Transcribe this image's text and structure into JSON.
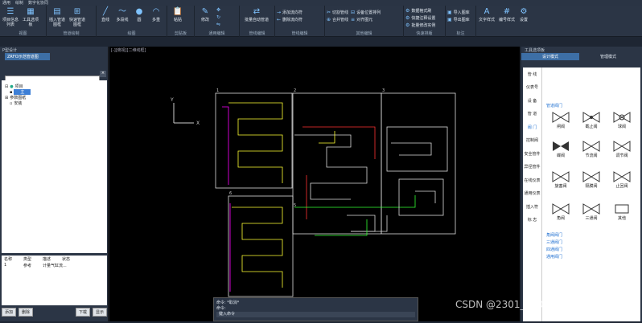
{
  "menubar": {
    "items": [
      "通用",
      "绘制",
      "数字化协同"
    ]
  },
  "ribbon": {
    "groups": [
      {
        "label": "视图",
        "buttons": [
          "项目信息列表",
          "工具选项板"
        ]
      },
      {
        "label": "管道绘制",
        "buttons": [
          "插入管道图框",
          "快速管道图框"
        ]
      },
      {
        "label": "绘图",
        "buttons": [
          "直线",
          "多段线",
          "圆",
          "多重"
        ]
      },
      {
        "label": "剪贴板",
        "buttons": [
          "粘贴"
        ]
      },
      {
        "label": "通用编辑",
        "buttons": [
          "修改"
        ]
      },
      {
        "label": "管线编辑",
        "buttons": [
          "批量自动管道"
        ]
      },
      {
        "label": "管线编辑2",
        "small": [
          "添加流向符",
          "删除流向符"
        ]
      },
      {
        "label": "其他编辑",
        "small": [
          "切割管线",
          "合并管线",
          "设备位置排列",
          "对齐图元"
        ]
      },
      {
        "label": "快速排版",
        "small": [
          "数据格式刷",
          "快捷注释设置",
          "批量修改实例"
        ]
      },
      {
        "label": "标注",
        "small": [
          "导入图库",
          "导出图库"
        ]
      },
      {
        "label": "标注2",
        "buttons": [
          "文字样式",
          "编号样式",
          "设置"
        ]
      }
    ]
  },
  "left": {
    "title": "P型设计",
    "tab": "ZRFO示范管道图",
    "search_placeholder": "",
    "tree": [
      "项目",
      "主",
      "参数图纸",
      "安装"
    ],
    "props_headers": [
      "名称",
      "类型",
      "描述",
      "状态"
    ],
    "props_row": [
      "1",
      "参考",
      "计量气缸流..."
    ],
    "footer": [
      "添加",
      "删除",
      "下载",
      "显示"
    ]
  },
  "canvas": {
    "doc_label": "[-][俯视][二维线框]",
    "cmd_lines": [
      "命令: *取消*",
      "命令:",
      "键入命令"
    ]
  },
  "right": {
    "title": "工具选项板",
    "tabs": [
      "设计模式",
      "管理模式"
    ],
    "categories": [
      "管  线",
      "仪表号",
      "设  备",
      "管  道",
      "阀  门",
      "控制阀",
      "安全管件",
      "异径管件",
      "在线仪表",
      "通用仪表",
      "插入符",
      "标  志"
    ],
    "group_label": "管道阀门",
    "symbols": [
      "闸阀",
      "截止阀",
      "球阀",
      "蝶阀",
      "节流阀",
      "调节阀",
      "旋塞阀",
      "隔膜阀",
      "止回阀",
      "角阀",
      "三通阀",
      "其他"
    ],
    "subgroups": [
      "角阀阀门",
      "三通阀门",
      "四通阀门",
      "通用阀门"
    ]
  },
  "watermark": "CSDN @2301_77095385",
  "colors": {
    "accent": "#3d6fa6",
    "bg": "#1e2633",
    "canvas": "#000000"
  }
}
